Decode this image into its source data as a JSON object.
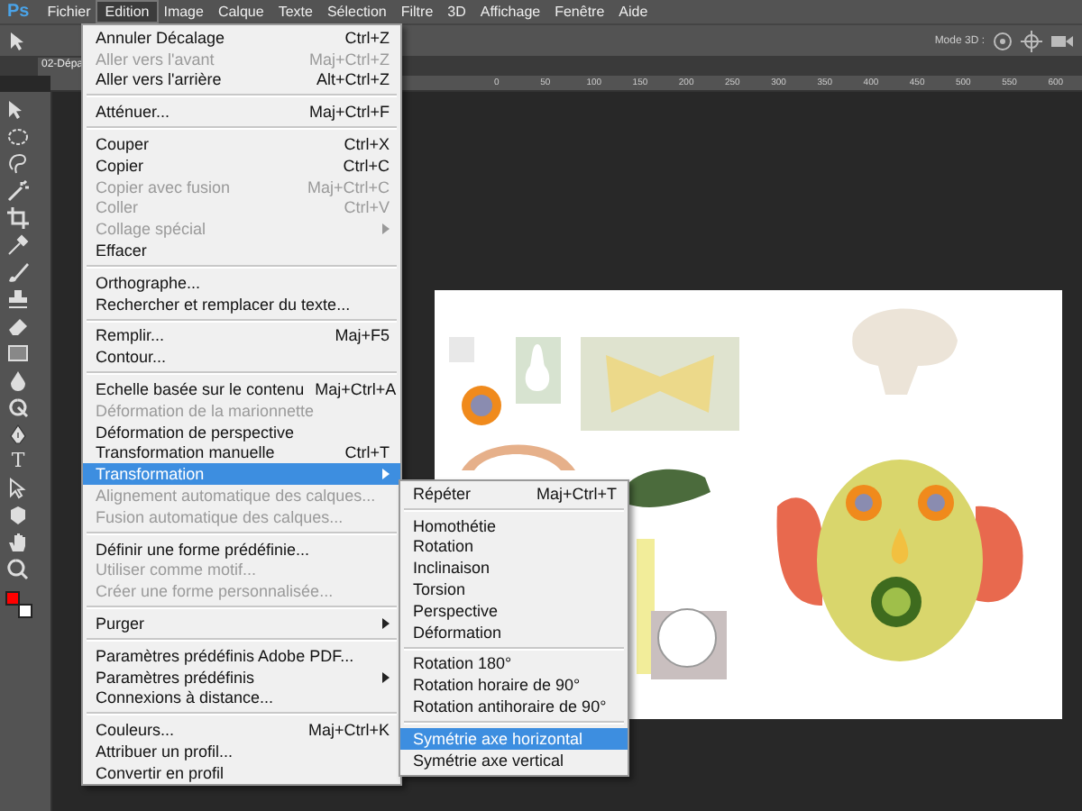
{
  "app": {
    "logo": "Ps"
  },
  "menubar": [
    {
      "label": "Fichier",
      "selected": false
    },
    {
      "label": "Edition",
      "selected": true
    },
    {
      "label": "Image",
      "selected": false
    },
    {
      "label": "Calque",
      "selected": false
    },
    {
      "label": "Texte",
      "selected": false
    },
    {
      "label": "Sélection",
      "selected": false
    },
    {
      "label": "Filtre",
      "selected": false
    },
    {
      "label": "3D",
      "selected": false
    },
    {
      "label": "Affichage",
      "selected": false
    },
    {
      "label": "Fenêtre",
      "selected": false
    },
    {
      "label": "Aide",
      "selected": false
    }
  ],
  "options_bar": {
    "mode_3d_label": "Mode 3D :"
  },
  "document_tab": {
    "title": "02-Dépa"
  },
  "ruler": {
    "labels": [
      "0",
      "50",
      "100",
      "150",
      "200",
      "250",
      "300",
      "350",
      "400",
      "450",
      "500",
      "550",
      "600"
    ]
  },
  "toolbar": {
    "tools": [
      {
        "kind": "move"
      },
      {
        "kind": "marquee"
      },
      {
        "kind": "lasso"
      },
      {
        "kind": "wand"
      },
      {
        "kind": "crop"
      },
      {
        "kind": "eyedropper"
      },
      {
        "kind": "brush"
      },
      {
        "kind": "stamp"
      },
      {
        "kind": "eraser"
      },
      {
        "kind": "gradient"
      },
      {
        "kind": "drop"
      },
      {
        "kind": "dodge"
      },
      {
        "kind": "pen"
      },
      {
        "kind": "text",
        "glyph": "T"
      },
      {
        "kind": "path"
      },
      {
        "kind": "shape"
      },
      {
        "kind": "hand"
      },
      {
        "kind": "zoom"
      }
    ],
    "swatches": [
      {
        "kind": "background",
        "color": "#ffffff"
      },
      {
        "kind": "foreground",
        "color": "#ff0000"
      }
    ]
  },
  "edit_menu": [
    {
      "kind": "item",
      "label": "Annuler Décalage",
      "shortcut": "Ctrl+Z",
      "disabled": false,
      "submenu": false,
      "selected": false
    },
    {
      "kind": "item",
      "label": "Aller vers l'avant",
      "shortcut": "Maj+Ctrl+Z",
      "disabled": true,
      "submenu": false,
      "selected": false
    },
    {
      "kind": "item",
      "label": "Aller vers l'arrière",
      "shortcut": "Alt+Ctrl+Z",
      "disabled": false,
      "submenu": false,
      "selected": false
    },
    {
      "kind": "separator"
    },
    {
      "kind": "item",
      "label": "Atténuer...",
      "shortcut": "Maj+Ctrl+F",
      "disabled": false,
      "submenu": false,
      "selected": false
    },
    {
      "kind": "separator"
    },
    {
      "kind": "item",
      "label": "Couper",
      "shortcut": "Ctrl+X",
      "disabled": false,
      "submenu": false,
      "selected": false
    },
    {
      "kind": "item",
      "label": "Copier",
      "shortcut": "Ctrl+C",
      "disabled": false,
      "submenu": false,
      "selected": false
    },
    {
      "kind": "item",
      "label": "Copier avec fusion",
      "shortcut": "Maj+Ctrl+C",
      "disabled": true,
      "submenu": false,
      "selected": false
    },
    {
      "kind": "item",
      "label": "Coller",
      "shortcut": "Ctrl+V",
      "disabled": true,
      "submenu": false,
      "selected": false
    },
    {
      "kind": "item",
      "label": "Collage spécial",
      "disabled": true,
      "submenu": true,
      "selected": false
    },
    {
      "kind": "item",
      "label": "Effacer",
      "disabled": false,
      "submenu": false,
      "selected": false
    },
    {
      "kind": "separator"
    },
    {
      "kind": "item",
      "label": "Orthographe...",
      "disabled": false,
      "submenu": false,
      "selected": false
    },
    {
      "kind": "item",
      "label": "Rechercher et remplacer du texte...",
      "disabled": false,
      "submenu": false,
      "selected": false
    },
    {
      "kind": "separator"
    },
    {
      "kind": "item",
      "label": "Remplir...",
      "shortcut": "Maj+F5",
      "disabled": false,
      "submenu": false,
      "selected": false
    },
    {
      "kind": "item",
      "label": "Contour...",
      "disabled": false,
      "submenu": false,
      "selected": false
    },
    {
      "kind": "separator"
    },
    {
      "kind": "item",
      "label": "Echelle basée sur le contenu",
      "shortcut": "Maj+Ctrl+A",
      "disabled": false,
      "submenu": false,
      "selected": false
    },
    {
      "kind": "item",
      "label": "Déformation de la marionnette",
      "disabled": true,
      "submenu": false,
      "selected": false
    },
    {
      "kind": "item",
      "label": "Déformation de perspective",
      "disabled": false,
      "submenu": false,
      "selected": false
    },
    {
      "kind": "item",
      "label": "Transformation manuelle",
      "shortcut": "Ctrl+T",
      "disabled": false,
      "submenu": false,
      "selected": false
    },
    {
      "kind": "item",
      "label": "Transformation",
      "disabled": false,
      "submenu": true,
      "selected": true
    },
    {
      "kind": "item",
      "label": "Alignement automatique des calques...",
      "disabled": true,
      "submenu": false,
      "selected": false
    },
    {
      "kind": "item",
      "label": "Fusion automatique des calques...",
      "disabled": true,
      "submenu": false,
      "selected": false
    },
    {
      "kind": "separator"
    },
    {
      "kind": "item",
      "label": "Définir une forme prédéfinie...",
      "disabled": false,
      "submenu": false,
      "selected": false
    },
    {
      "kind": "item",
      "label": "Utiliser comme motif...",
      "disabled": true,
      "submenu": false,
      "selected": false
    },
    {
      "kind": "item",
      "label": "Créer une forme personnalisée...",
      "disabled": true,
      "submenu": false,
      "selected": false
    },
    {
      "kind": "separator"
    },
    {
      "kind": "item",
      "label": "Purger",
      "disabled": false,
      "submenu": true,
      "selected": false
    },
    {
      "kind": "separator"
    },
    {
      "kind": "item",
      "label": "Paramètres prédéfinis Adobe PDF...",
      "disabled": false,
      "submenu": false,
      "selected": false
    },
    {
      "kind": "item",
      "label": "Paramètres prédéfinis",
      "disabled": false,
      "submenu": true,
      "selected": false
    },
    {
      "kind": "item",
      "label": "Connexions à distance...",
      "disabled": false,
      "submenu": false,
      "selected": false
    },
    {
      "kind": "separator"
    },
    {
      "kind": "item",
      "label": "Couleurs...",
      "shortcut": "Maj+Ctrl+K",
      "disabled": false,
      "submenu": false,
      "selected": false
    },
    {
      "kind": "item",
      "label": "Attribuer un profil...",
      "disabled": false,
      "submenu": false,
      "selected": false
    },
    {
      "kind": "item",
      "label": "Convertir en profil",
      "disabled": false,
      "submenu": false,
      "selected": false
    }
  ],
  "transform_submenu": [
    {
      "kind": "item",
      "label": "Répéter",
      "shortcut": "Maj+Ctrl+T",
      "selected": false
    },
    {
      "kind": "separator"
    },
    {
      "kind": "item",
      "label": "Homothétie",
      "selected": false
    },
    {
      "kind": "item",
      "label": "Rotation",
      "selected": false
    },
    {
      "kind": "item",
      "label": "Inclinaison",
      "selected": false
    },
    {
      "kind": "item",
      "label": "Torsion",
      "selected": false
    },
    {
      "kind": "item",
      "label": "Perspective",
      "selected": false
    },
    {
      "kind": "item",
      "label": "Déformation",
      "selected": false
    },
    {
      "kind": "separator"
    },
    {
      "kind": "item",
      "label": "Rotation 180°",
      "selected": false
    },
    {
      "kind": "item",
      "label": "Rotation horaire de 90°",
      "selected": false
    },
    {
      "kind": "item",
      "label": "Rotation antihoraire de 90°",
      "selected": false
    },
    {
      "kind": "separator"
    },
    {
      "kind": "item",
      "label": "Symétrie axe horizontal",
      "selected": true
    },
    {
      "kind": "item",
      "label": "Symétrie axe vertical",
      "selected": false
    }
  ]
}
